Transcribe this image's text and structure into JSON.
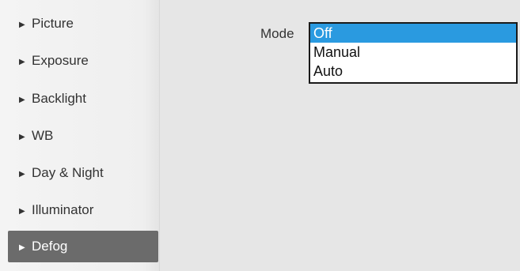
{
  "sidebar": {
    "items": [
      {
        "label": "Picture"
      },
      {
        "label": "Exposure"
      },
      {
        "label": "Backlight"
      },
      {
        "label": "WB"
      },
      {
        "label": "Day & Night"
      },
      {
        "label": "Illuminator"
      },
      {
        "label": "Defog",
        "active": true
      }
    ],
    "arrow_glyph": "▶"
  },
  "main": {
    "mode_label": "Mode",
    "mode_dropdown": {
      "selected": "Off",
      "options": [
        "Off",
        "Manual",
        "Auto"
      ]
    }
  },
  "colors": {
    "active_item_bg": "#6b6b6b",
    "selected_option_bg": "#2a9ae0"
  }
}
